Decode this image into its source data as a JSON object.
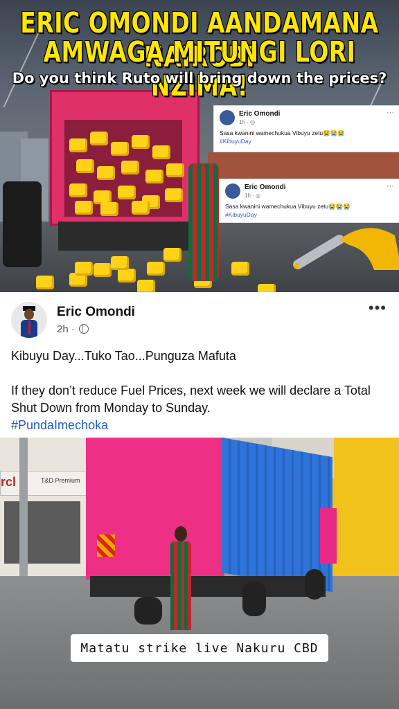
{
  "banner": {
    "headline_line1": "ERIC OMONDI AANDAMANA NAIROBI",
    "headline_line2": "AMWAGA MITUNGI LORI NZIMA!",
    "subheadline": "Do you think Ruto will bring down the prices?",
    "cards": [
      {
        "name": "Eric Omondi",
        "meta": "1h · ",
        "text": "Sasa kwanini wamechukua Vibuyu zetu😭😭😭",
        "hashtag": "#KibuyuDay",
        "more": "···"
      },
      {
        "name": "Eric Omondi",
        "meta": "1h · ",
        "text": "Sasa kwanini wamechukua Vibuyu zetu😭😭😭",
        "hashtag": "#KibuyuDay",
        "more": "···"
      }
    ]
  },
  "post": {
    "author": "Eric Omondi",
    "time": "2h · ",
    "more": "•••",
    "line1": "Kibuyu Day...Tuko Tao...Punguza Mafuta",
    "line2": "If they don’t reduce Fuel Prices, next week we will declare a Total Shut Down from Monday to Sunday.",
    "hashtag": "#PundaImechoka"
  },
  "video": {
    "caption": "Matatu strike live Nakuru CBD",
    "sign_brand": "rcl",
    "sign_text": "T&D Premium"
  },
  "colors": {
    "headline_yellow": "#ffe600",
    "hashtag_blue": "#1f5cbf",
    "truck_pink": "#ee2f86",
    "truck_blue": "#2f74d8"
  }
}
